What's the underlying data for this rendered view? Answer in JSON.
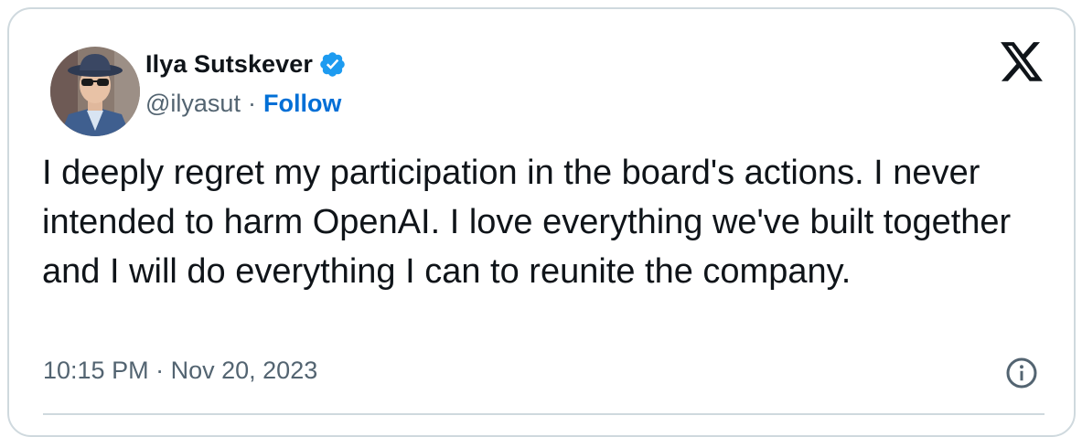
{
  "tweet": {
    "author": {
      "name": "Ilya Sutskever",
      "handle": "@ilyasut",
      "verified": true
    },
    "separator": "·",
    "follow_label": "Follow",
    "text": "I deeply regret my participation in the board's actions. I never intended to harm OpenAI. I love everything we've built together and I will do everything I can to reunite the company.",
    "time": "10:15 PM",
    "date": "Nov 20, 2023"
  },
  "icons": {
    "verified": "verified-badge-icon",
    "brand": "x-logo-icon",
    "info": "info-icon"
  },
  "colors": {
    "text_primary": "#0f1419",
    "text_secondary": "#536471",
    "link": "#006fd6",
    "verified": "#1d9bf0",
    "border": "#cfd9de"
  }
}
